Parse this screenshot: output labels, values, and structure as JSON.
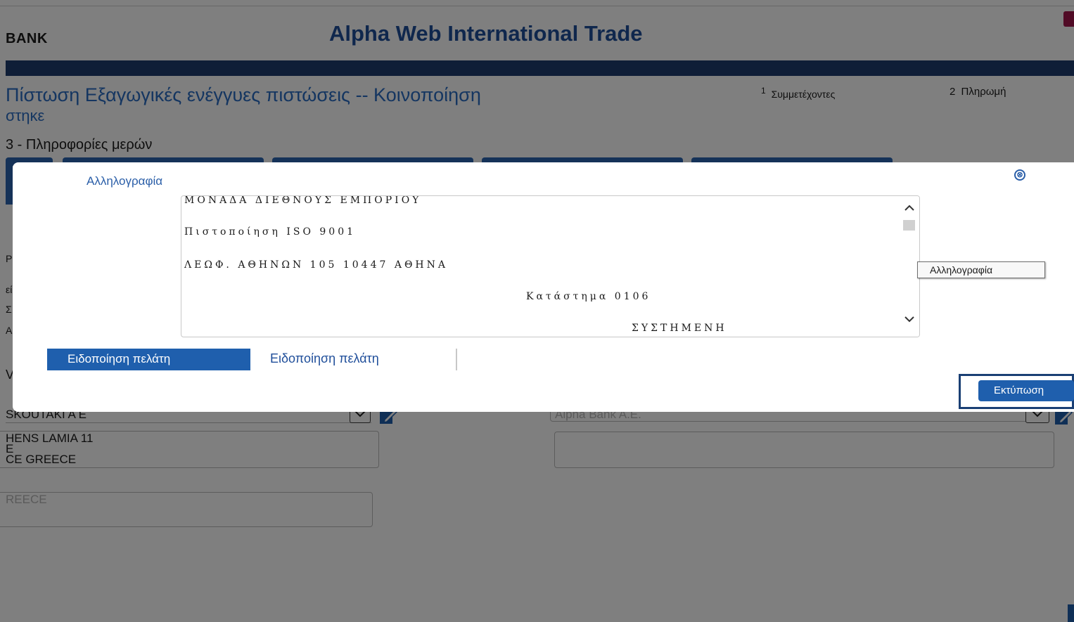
{
  "page": {
    "brand": "BANK",
    "app_title": "Alpha Web International Trade",
    "heading_line1": "Πίστωση Εξαγωγικές ενέγγυες πιστώσεις -- Κοινοποίηση",
    "heading_line2": "στηκε",
    "steps": [
      {
        "num": "1",
        "label": "Συμμετέχοντες"
      },
      {
        "num": "2",
        "label": "Πληρωμή"
      }
    ],
    "section_title": "3 - Πληροφορίες μερών",
    "fragments": {
      "f1": "Ρ",
      "f2": "εί",
      "f3": "Σ",
      "f4": "ΑΝ",
      "f5": "V"
    },
    "left_party": {
      "name": "SKOUTAKI A E",
      "address_lines": [
        "HENS LAMIA 11",
        "E",
        "CE GREECE"
      ],
      "country_placeholder": "REECE"
    },
    "right_party": {
      "name": "Alpha Bank A.E."
    }
  },
  "dialog": {
    "title": "Αλληλογραφία",
    "close_symbol": "⊗",
    "letter_lines": [
      "ΜΟΝΑΔΑ ΔΙΕΘΝΟΥΣ ΕΜΠΟΡΙΟΥ",
      "Πιστοποίηση ISO 9001",
      "ΛΕΩΦ. ΑΘΗΝΩΝ 105 10447 ΑΘΗΝΑ",
      "Κατάστημα 0106",
      "ΣΥΣΤΗΜΕΝΗ"
    ],
    "tooltip": "Αλληλογραφία",
    "tabs": [
      {
        "label": "Ειδοποίηση πελάτη",
        "active": true
      },
      {
        "label": "Ειδοποίηση πελάτη",
        "active": false
      }
    ],
    "print_label": "Εκτύπωση"
  },
  "colors": {
    "primary": "#1f5fad",
    "title_blue": "#1f4e9a",
    "navbar": "#1f3d6e",
    "brand_accent": "#a3174c"
  }
}
